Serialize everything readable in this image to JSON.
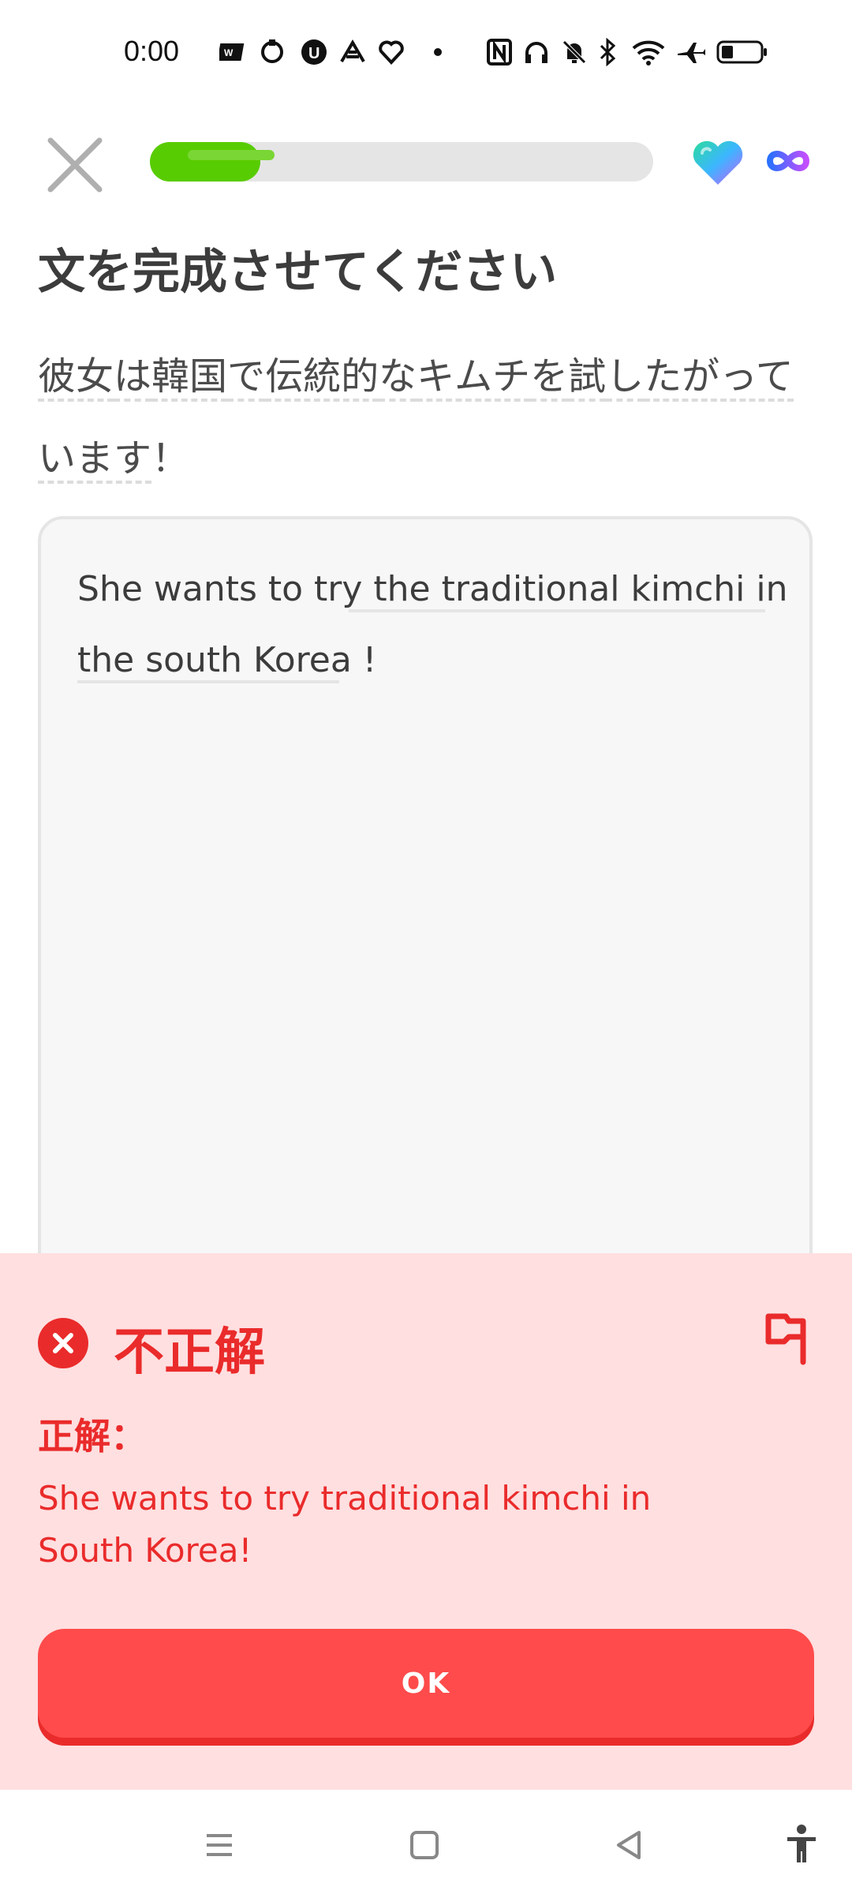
{
  "status_bar": {
    "time": "0:00",
    "icons": [
      "wnw-app-icon",
      "sync-icon",
      "u-app-icon",
      "leaf-app-icon",
      "heart-app-icon",
      "dot-icon",
      "nfc-icon",
      "headphones-icon",
      "bell-off-icon",
      "bluetooth-icon",
      "wifi-icon",
      "airplane-icon",
      "battery-icon"
    ]
  },
  "header": {
    "progress_fraction": 0.22,
    "hearts": "infinite"
  },
  "lesson": {
    "title": "文を完成させてください",
    "prompt_words": [
      "彼女",
      "は",
      "韓国",
      "で",
      "伝統的",
      "な",
      "キムチ",
      "を",
      "試",
      "し",
      "たがって"
    ],
    "prompt_line2": "います",
    "prompt_punct": "！",
    "answer_prefix": "She wants to try ",
    "answer_line1_rest": "the traditional kimchi in",
    "answer_line2": "the south Korea !"
  },
  "feedback": {
    "title": "不正解",
    "label": "正解：",
    "correct_answer": "She wants to try traditional kimchi in South Korea!",
    "button": "OK"
  },
  "colors": {
    "green": "#58cc02",
    "red": "#ea2b2b",
    "button_red": "#ff4b4b",
    "feedback_bg": "#ffdfe0"
  }
}
